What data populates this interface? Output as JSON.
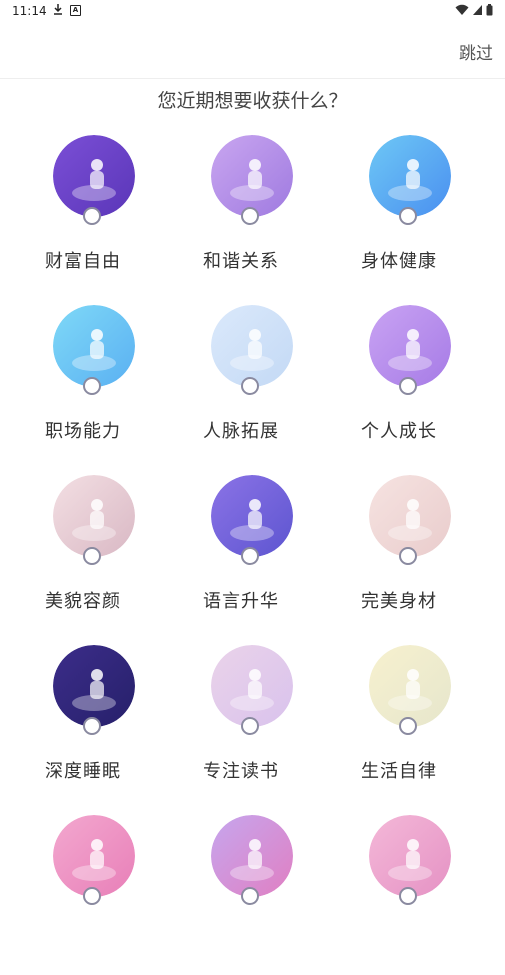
{
  "status_bar": {
    "time": "11:14"
  },
  "header": {
    "skip_label": "跳过"
  },
  "question": "您近期想要收获什么？",
  "goals": [
    {
      "label": "财富自由",
      "icon": "wealth-illustration-icon",
      "bg1": "#7b4fd6",
      "bg2": "#5a36b8"
    },
    {
      "label": "和谐关系",
      "icon": "relationship-illustration-icon",
      "bg1": "#c9a6f0",
      "bg2": "#9f7ae0"
    },
    {
      "label": "身体健康",
      "icon": "health-illustration-icon",
      "bg1": "#6ec8f5",
      "bg2": "#4a8ff0"
    },
    {
      "label": "职场能力",
      "icon": "career-illustration-icon",
      "bg1": "#7fd9f7",
      "bg2": "#5ab0f2"
    },
    {
      "label": "人脉拓展",
      "icon": "network-illustration-icon",
      "bg1": "#dbe9fb",
      "bg2": "#c3d9f5"
    },
    {
      "label": "个人成长",
      "icon": "growth-illustration-icon",
      "bg1": "#c9a3f3",
      "bg2": "#a67be6"
    },
    {
      "label": "美貌容颜",
      "icon": "beauty-illustration-icon",
      "bg1": "#f3dfe3",
      "bg2": "#d9b8c4"
    },
    {
      "label": "语言升华",
      "icon": "language-illustration-icon",
      "bg1": "#8b73e6",
      "bg2": "#5d55d0"
    },
    {
      "label": "完美身材",
      "icon": "fitness-illustration-icon",
      "bg1": "#f6e3e1",
      "bg2": "#e9cccc"
    },
    {
      "label": "深度睡眠",
      "icon": "sleep-illustration-icon",
      "bg1": "#3c2d8a",
      "bg2": "#26206a"
    },
    {
      "label": "专注读书",
      "icon": "reading-illustration-icon",
      "bg1": "#ead3ea",
      "bg2": "#d9c2ec"
    },
    {
      "label": "生活自律",
      "icon": "discipline-illustration-icon",
      "bg1": "#f7f1cf",
      "bg2": "#e6e6cc"
    },
    {
      "label": "",
      "icon": "fun-illustration-icon",
      "bg1": "#f3a8cf",
      "bg2": "#e87fb8"
    },
    {
      "label": "",
      "icon": "romance-illustration-icon",
      "bg1": "#c6a6ee",
      "bg2": "#e07fc2"
    },
    {
      "label": "",
      "icon": "wedding-illustration-icon",
      "bg1": "#f4b8d8",
      "bg2": "#e592c4"
    }
  ]
}
